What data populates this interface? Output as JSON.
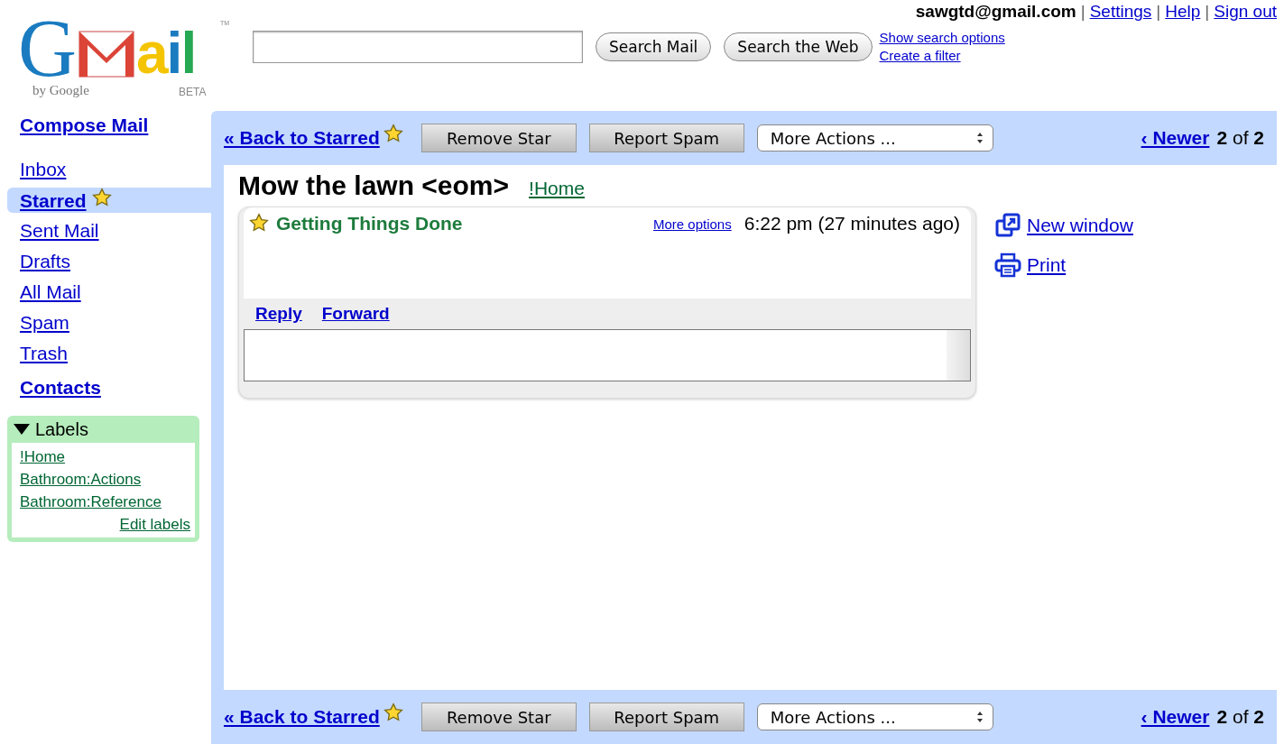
{
  "logo": {
    "first": "G",
    "rest": "ail",
    "trademark": "TM",
    "byline": "by Google",
    "tag": "BETA"
  },
  "header": {
    "account": "sawgtd@gmail.com",
    "links": [
      "Settings",
      "Help",
      "Sign out"
    ],
    "separator": "|"
  },
  "search": {
    "buttons": [
      "Search Mail",
      "Search the Web"
    ],
    "links": [
      "Show search options",
      "Create a filter"
    ]
  },
  "sidebar": {
    "compose": "Compose Mail",
    "items": [
      {
        "label": "Inbox",
        "selected": false,
        "starred": false
      },
      {
        "label": "Starred",
        "selected": true,
        "starred": true
      },
      {
        "label": "Sent Mail",
        "selected": false,
        "starred": false
      },
      {
        "label": "Drafts",
        "selected": false,
        "starred": false
      },
      {
        "label": "All Mail",
        "selected": false,
        "starred": false
      },
      {
        "label": "Spam",
        "selected": false,
        "starred": false
      },
      {
        "label": "Trash",
        "selected": false,
        "starred": false
      }
    ],
    "contacts": "Contacts",
    "labels": {
      "title": "Labels",
      "expanded": true,
      "items": [
        "!Home",
        "Bathroom:Actions",
        "Bathroom:Reference"
      ],
      "edit": "Edit labels"
    }
  },
  "toolbars": [
    {
      "back": "« Back to Starred",
      "buttons": [
        "Remove Star",
        "Report Spam"
      ],
      "select": "More Actions ...",
      "newer": "‹ Newer",
      "count": "**2** of **2**"
    },
    {
      "back": "« Back to Starred",
      "buttons": [
        "Remove Star",
        "Report Spam"
      ],
      "select": "More Actions ...",
      "newer": "‹ Newer",
      "count": "**2** of **2**"
    }
  ],
  "conversation": {
    "subject": "Mow the lawn <eom>",
    "label": "!Home",
    "message": {
      "starred": true,
      "sender": "Getting Things Done",
      "more_options": "More options",
      "time": "6:22 pm (27 minutes ago)",
      "actions": [
        "Reply",
        "Forward"
      ]
    },
    "side_actions": [
      {
        "kind": "new-window",
        "label": "New window"
      },
      {
        "kind": "print",
        "label": "Print"
      }
    ]
  }
}
